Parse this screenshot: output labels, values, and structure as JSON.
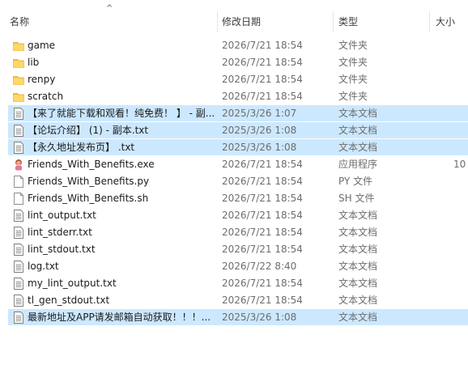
{
  "header": {
    "sort_arrow": "^",
    "columns": [
      "名称",
      "修改日期",
      "类型",
      "大小"
    ]
  },
  "colors": {
    "selection": "#cce8ff",
    "folder": "#f5c54b",
    "text_gray": "#6d6d6d"
  },
  "files": [
    {
      "name": "game",
      "date": "2026/7/21 18:54",
      "type": "文件夹",
      "size": "",
      "icon": "folder-icon",
      "selected": false
    },
    {
      "name": "lib",
      "date": "2026/7/21 18:54",
      "type": "文件夹",
      "size": "",
      "icon": "folder-icon",
      "selected": false
    },
    {
      "name": "renpy",
      "date": "2026/7/21 18:54",
      "type": "文件夹",
      "size": "",
      "icon": "folder-icon",
      "selected": false
    },
    {
      "name": "scratch",
      "date": "2026/7/21 18:54",
      "type": "文件夹",
      "size": "",
      "icon": "folder-icon",
      "selected": false
    },
    {
      "name": "【来了就能下载和观看！纯免费！ 】 - 副...",
      "date": "2025/3/26 1:07",
      "type": "文本文档",
      "size": "",
      "icon": "text-document-icon",
      "selected": true
    },
    {
      "name": "【论坛介绍】 (1) - 副本.txt",
      "date": "2025/3/26 1:08",
      "type": "文本文档",
      "size": "",
      "icon": "text-document-icon",
      "selected": true
    },
    {
      "name": "【永久地址发布页】 .txt",
      "date": "2025/3/26 1:08",
      "type": "文本文档",
      "size": "",
      "icon": "text-document-icon",
      "selected": true
    },
    {
      "name": "Friends_With_Benefits.exe",
      "date": "2026/7/21 18:54",
      "type": "应用程序",
      "size": "10",
      "icon": "application-icon",
      "selected": false
    },
    {
      "name": "Friends_With_Benefits.py",
      "date": "2026/7/21 18:54",
      "type": "PY 文件",
      "size": "",
      "icon": "blank-file-icon",
      "selected": false
    },
    {
      "name": "Friends_With_Benefits.sh",
      "date": "2026/7/21 18:54",
      "type": "SH 文件",
      "size": "",
      "icon": "blank-file-icon",
      "selected": false
    },
    {
      "name": "lint_output.txt",
      "date": "2026/7/21 18:54",
      "type": "文本文档",
      "size": "",
      "icon": "text-document-icon",
      "selected": false
    },
    {
      "name": "lint_stderr.txt",
      "date": "2026/7/21 18:54",
      "type": "文本文档",
      "size": "",
      "icon": "text-document-icon",
      "selected": false
    },
    {
      "name": "lint_stdout.txt",
      "date": "2026/7/21 18:54",
      "type": "文本文档",
      "size": "",
      "icon": "text-document-icon",
      "selected": false
    },
    {
      "name": "log.txt",
      "date": "2026/7/22 8:40",
      "type": "文本文档",
      "size": "",
      "icon": "text-document-icon",
      "selected": false
    },
    {
      "name": "my_lint_output.txt",
      "date": "2026/7/21 18:54",
      "type": "文本文档",
      "size": "",
      "icon": "text-document-icon",
      "selected": false
    },
    {
      "name": "tl_gen_stdout.txt",
      "date": "2026/7/21 18:54",
      "type": "文本文档",
      "size": "",
      "icon": "text-document-icon",
      "selected": false
    },
    {
      "name": "最新地址及APP请发邮箱自动获取！！！...",
      "date": "2025/3/26 1:08",
      "type": "文本文档",
      "size": "",
      "icon": "text-document-icon",
      "selected": true
    }
  ]
}
